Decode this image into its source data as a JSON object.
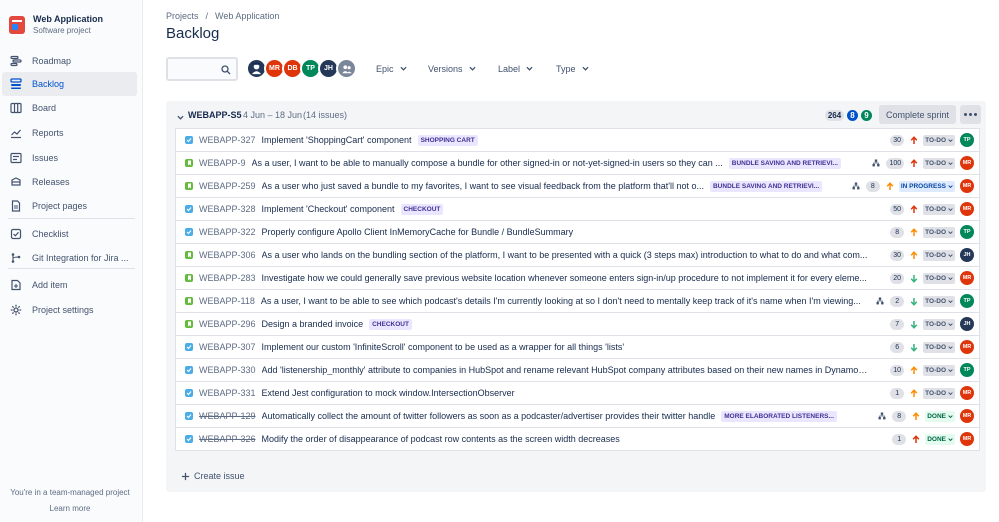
{
  "project": {
    "name": "Web Application",
    "type": "Software project"
  },
  "nav": [
    {
      "label": "Roadmap",
      "icon": "roadmap-icon"
    },
    {
      "label": "Backlog",
      "icon": "backlog-icon",
      "active": true
    },
    {
      "label": "Board",
      "icon": "board-icon"
    },
    {
      "label": "Reports",
      "icon": "reports-icon"
    },
    {
      "label": "Issues",
      "icon": "issues-icon"
    },
    {
      "label": "Releases",
      "icon": "releases-icon"
    },
    {
      "label": "Project pages",
      "icon": "pages-icon"
    },
    {
      "label": "Checklist",
      "icon": "checklist-icon"
    },
    {
      "label": "Git Integration for Jira ...",
      "icon": "git-icon"
    },
    {
      "label": "Add item",
      "icon": "add-item-icon"
    },
    {
      "label": "Project settings",
      "icon": "settings-icon"
    }
  ],
  "footer": {
    "note": "You're in a team-managed project",
    "learn_more": "Learn more"
  },
  "breadcrumb": {
    "root": "Projects",
    "separator": "/",
    "current": "Web Application"
  },
  "page_title": "Backlog",
  "search": {
    "placeholder": ""
  },
  "avatars": [
    {
      "initials": "",
      "color": "#253858",
      "kind": "photo"
    },
    {
      "initials": "MR",
      "color": "#de350b"
    },
    {
      "initials": "DB",
      "color": "#de350b"
    },
    {
      "initials": "TP",
      "color": "#00875a"
    },
    {
      "initials": "JH",
      "color": "#253858"
    },
    {
      "initials": "",
      "color": "#7a869a",
      "kind": "group"
    }
  ],
  "filters": [
    "Epic",
    "Versions",
    "Label",
    "Type"
  ],
  "sprint": {
    "name": "WEBAPP-S5",
    "dates": "4 Jun – 18 Jun",
    "count": "(14 issues)",
    "points": {
      "todo": "264",
      "in_progress": "8",
      "done": "9"
    },
    "complete_label": "Complete sprint"
  },
  "issues": [
    {
      "type": "task",
      "key": "WEBAPP-327",
      "summary": "Implement 'ShoppingCart' component",
      "epic": "SHOPPING CART",
      "subtasks": false,
      "estimate": "30",
      "priority": "high",
      "status": "TO-DO",
      "assignee": "TP",
      "assignee_color": "#00875a",
      "done": false
    },
    {
      "type": "story",
      "key": "WEBAPP-9",
      "summary": "As a user, I want to be able to manually compose a bundle for other signed-in or not-yet-signed-in users so they can ...",
      "epic": "BUNDLE SAVING AND RETRIEVI...",
      "subtasks": true,
      "estimate": "100",
      "priority": "high",
      "status": "TO-DO",
      "assignee": "MR",
      "assignee_color": "#de350b",
      "done": false
    },
    {
      "type": "story",
      "key": "WEBAPP-259",
      "summary": "As a user who just saved a bundle to my favorites, I want to see visual feedback from the platform that'll not o...",
      "epic": "BUNDLE SAVING AND RETRIEVI...",
      "subtasks": true,
      "estimate": "8",
      "priority": "medium",
      "status": "IN PROGRESS",
      "assignee": "MR",
      "assignee_color": "#de350b",
      "done": false
    },
    {
      "type": "task",
      "key": "WEBAPP-328",
      "summary": "Implement 'Checkout' component",
      "epic": "CHECKOUT",
      "subtasks": false,
      "estimate": "50",
      "priority": "high",
      "status": "TO-DO",
      "assignee": "MR",
      "assignee_color": "#de350b",
      "done": false
    },
    {
      "type": "task",
      "key": "WEBAPP-322",
      "summary": "Properly configure Apollo Client InMemoryCache for Bundle / BundleSummary",
      "epic": "",
      "subtasks": false,
      "estimate": "8",
      "priority": "medium",
      "status": "TO-DO",
      "assignee": "TP",
      "assignee_color": "#00875a",
      "done": false
    },
    {
      "type": "story",
      "key": "WEBAPP-306",
      "summary": "As a user who lands on the bundling section of the platform, I want to be presented with a quick (3 steps max) introduction to what to do and what com...",
      "epic": "",
      "subtasks": false,
      "estimate": "30",
      "priority": "medium",
      "status": "TO-DO",
      "assignee": "JH",
      "assignee_color": "#253858",
      "done": false
    },
    {
      "type": "story",
      "key": "WEBAPP-283",
      "summary": "Investigate how we could generally save previous website location whenever someone enters sign-in/up procedure to not implement it for every eleme...",
      "epic": "",
      "subtasks": false,
      "estimate": "20",
      "priority": "low",
      "status": "TO-DO",
      "assignee": "MR",
      "assignee_color": "#de350b",
      "done": false
    },
    {
      "type": "story",
      "key": "WEBAPP-118",
      "summary": "As a user, I want to be able to see which podcast's details I'm currently looking at so I don't need to mentally keep track of it's name when I'm viewing...",
      "epic": "",
      "subtasks": true,
      "estimate": "2",
      "priority": "low",
      "status": "TO-DO",
      "assignee": "TP",
      "assignee_color": "#00875a",
      "done": false
    },
    {
      "type": "story",
      "key": "WEBAPP-296",
      "summary": "Design a branded invoice",
      "epic": "CHECKOUT",
      "subtasks": false,
      "estimate": "7",
      "priority": "low",
      "status": "TO-DO",
      "assignee": "JH",
      "assignee_color": "#253858",
      "done": false
    },
    {
      "type": "task",
      "key": "WEBAPP-307",
      "summary": "Implement our custom 'InfiniteScroll' component to be used as a wrapper for all things 'lists'",
      "epic": "",
      "subtasks": false,
      "estimate": "6",
      "priority": "low",
      "status": "TO-DO",
      "assignee": "MR",
      "assignee_color": "#de350b",
      "done": false
    },
    {
      "type": "task",
      "key": "WEBAPP-330",
      "summary": "Add 'listenership_monthly' attribute to companies in HubSpot and rename relevant HubSpot company attributes based on their new names in DynamoD...",
      "epic": "",
      "subtasks": false,
      "estimate": "10",
      "priority": "medium",
      "status": "TO-DO",
      "assignee": "TP",
      "assignee_color": "#00875a",
      "done": false
    },
    {
      "type": "task",
      "key": "WEBAPP-331",
      "summary": "Extend Jest configuration to mock window.IntersectionObserver",
      "epic": "",
      "subtasks": false,
      "estimate": "1",
      "priority": "medium",
      "status": "TO-DO",
      "assignee": "MR",
      "assignee_color": "#de350b",
      "done": false
    },
    {
      "type": "task",
      "key": "WEBAPP-129",
      "summary": "Automatically collect the amount of twitter followers as soon as a podcaster/advertiser provides their twitter handle",
      "epic": "MORE ELABORATED LISTENERS...",
      "subtasks": true,
      "estimate": "8",
      "priority": "medium",
      "status": "DONE",
      "assignee": "MR",
      "assignee_color": "#de350b",
      "done": true
    },
    {
      "type": "task",
      "key": "WEBAPP-326",
      "summary": "Modify the order of disappearance of podcast row contents as the screen width decreases",
      "epic": "",
      "subtasks": false,
      "estimate": "1",
      "priority": "high",
      "status": "DONE",
      "assignee": "MR",
      "assignee_color": "#de350b",
      "done": true
    }
  ],
  "create_issue_label": "Create issue"
}
